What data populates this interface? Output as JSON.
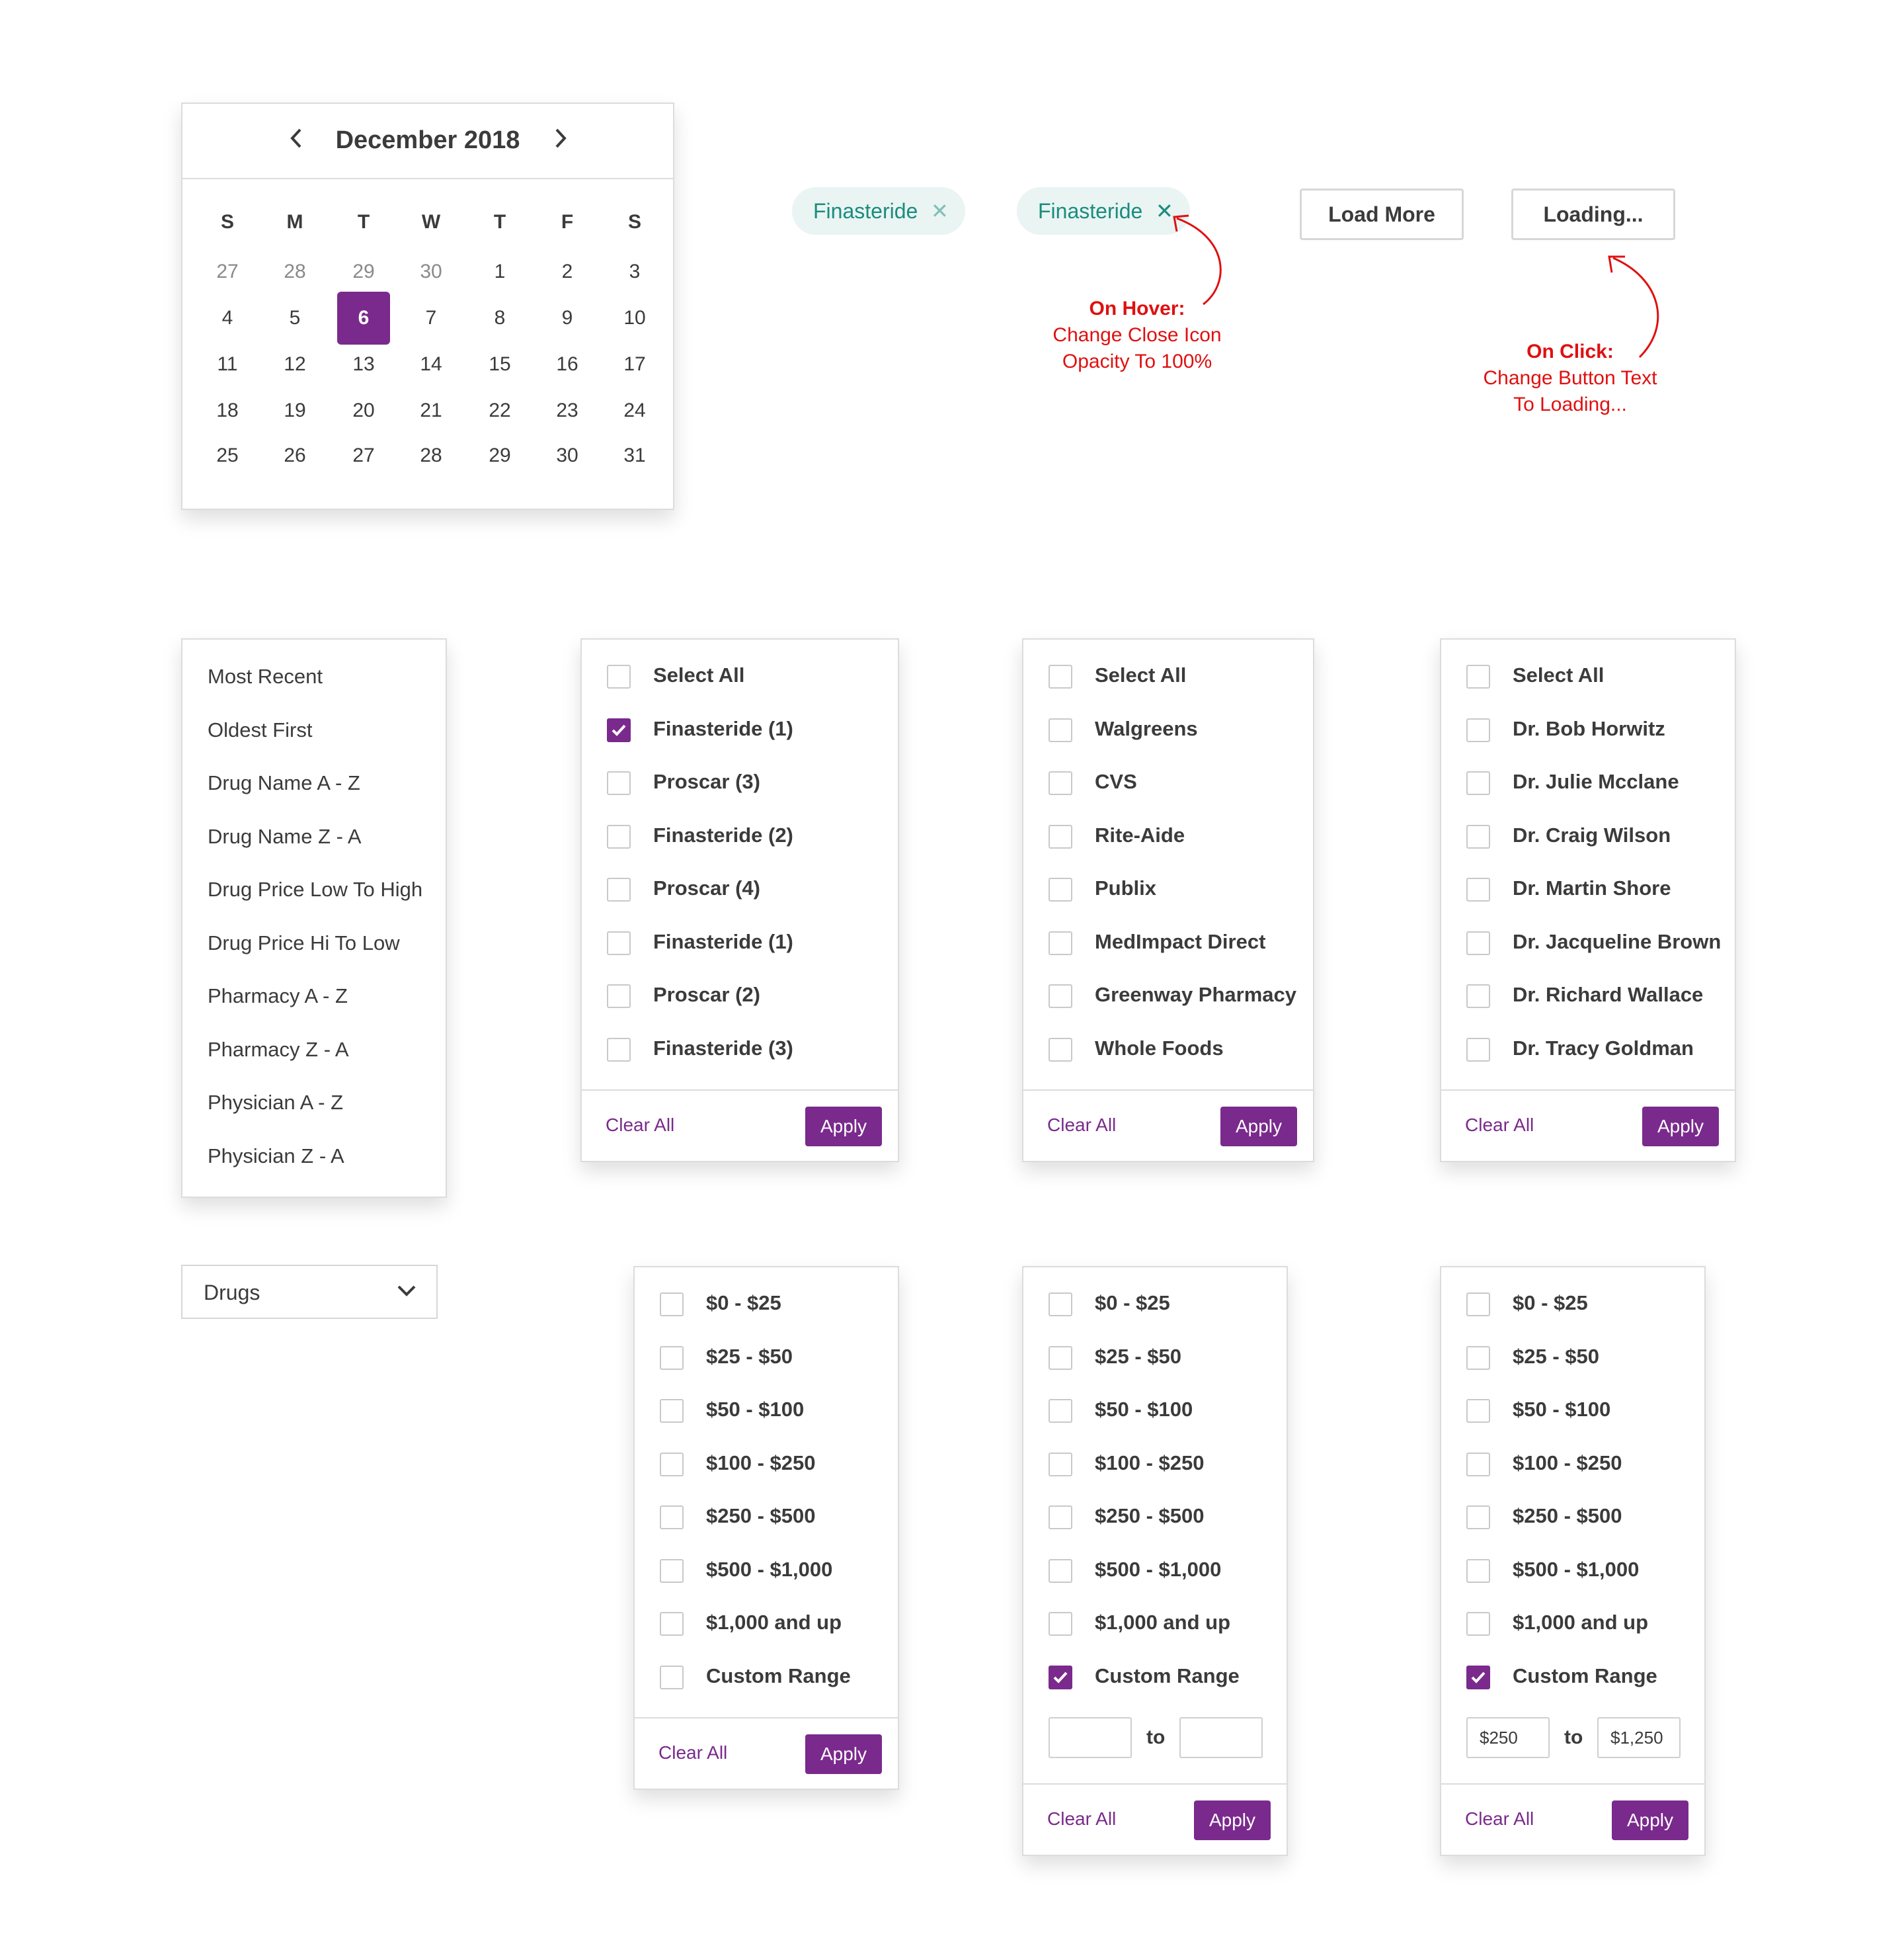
{
  "calendar": {
    "title": "December 2018",
    "weekdays": [
      "S",
      "M",
      "T",
      "W",
      "T",
      "F",
      "S"
    ],
    "days": [
      [
        "27",
        "28",
        "29",
        "30",
        "1",
        "2",
        "3"
      ],
      [
        "4",
        "5",
        "6",
        "7",
        "8",
        "9",
        "10"
      ],
      [
        "11",
        "12",
        "13",
        "14",
        "15",
        "16",
        "17"
      ],
      [
        "18",
        "19",
        "20",
        "21",
        "22",
        "23",
        "24"
      ],
      [
        "25",
        "26",
        "27",
        "28",
        "29",
        "30",
        "31"
      ]
    ],
    "selected": "6"
  },
  "chips": {
    "chip1": "Finasteride",
    "chip2": "Finasteride",
    "hover_note_title": "On Hover:",
    "hover_note_line1": "Change Close Icon",
    "hover_note_line2": "Opacity To 100%"
  },
  "buttons": {
    "load_more": "Load More",
    "loading": "Loading...",
    "click_note_title": "On Click:",
    "click_note_line1": "Change Button Text",
    "click_note_line2": "To Loading..."
  },
  "sort": {
    "items": [
      "Most Recent",
      "Oldest First",
      "Drug Name A - Z",
      "Drug Name Z - A",
      "Drug Price Low To High",
      "Drug Price Hi To Low",
      "Pharmacy A - Z",
      "Pharmacy Z - A",
      "Physician A - Z",
      "Physician Z - A"
    ]
  },
  "dropdown": {
    "value": "Drugs"
  },
  "filters": {
    "clear_all": "Clear All",
    "apply": "Apply",
    "to": "to",
    "drugs": [
      "Select All",
      "Finasteride (1)",
      "Proscar (3)",
      "Finasteride (2)",
      "Proscar (4)",
      "Finasteride (1)",
      "Proscar (2)",
      "Finasteride (3)"
    ],
    "pharmacies": [
      "Select All",
      "Walgreens",
      "CVS",
      "Rite-Aide",
      "Publix",
      "MedImpact Direct",
      "Greenway Pharmacy",
      "Whole Foods"
    ],
    "physicians": [
      "Select All",
      "Dr. Bob Horwitz",
      "Dr. Julie Mcclane",
      "Dr. Craig Wilson",
      "Dr. Martin Shore",
      "Dr. Jacqueline Brown",
      "Dr. Richard Wallace",
      "Dr. Tracy Goldman"
    ],
    "prices": [
      "$0 - $25",
      "$25 - $50",
      "$50 - $100",
      "$100 - $250",
      "$250 - $500",
      "$500 - $1,000",
      "$1,000 and up",
      "Custom Range"
    ],
    "custom_min": "$250",
    "custom_max": "$1,250"
  },
  "colors": {
    "accent": "#7a2a8c",
    "chip_text": "#1a8c7e",
    "chip_bg": "#e9f4f3",
    "note": "#e01010"
  }
}
